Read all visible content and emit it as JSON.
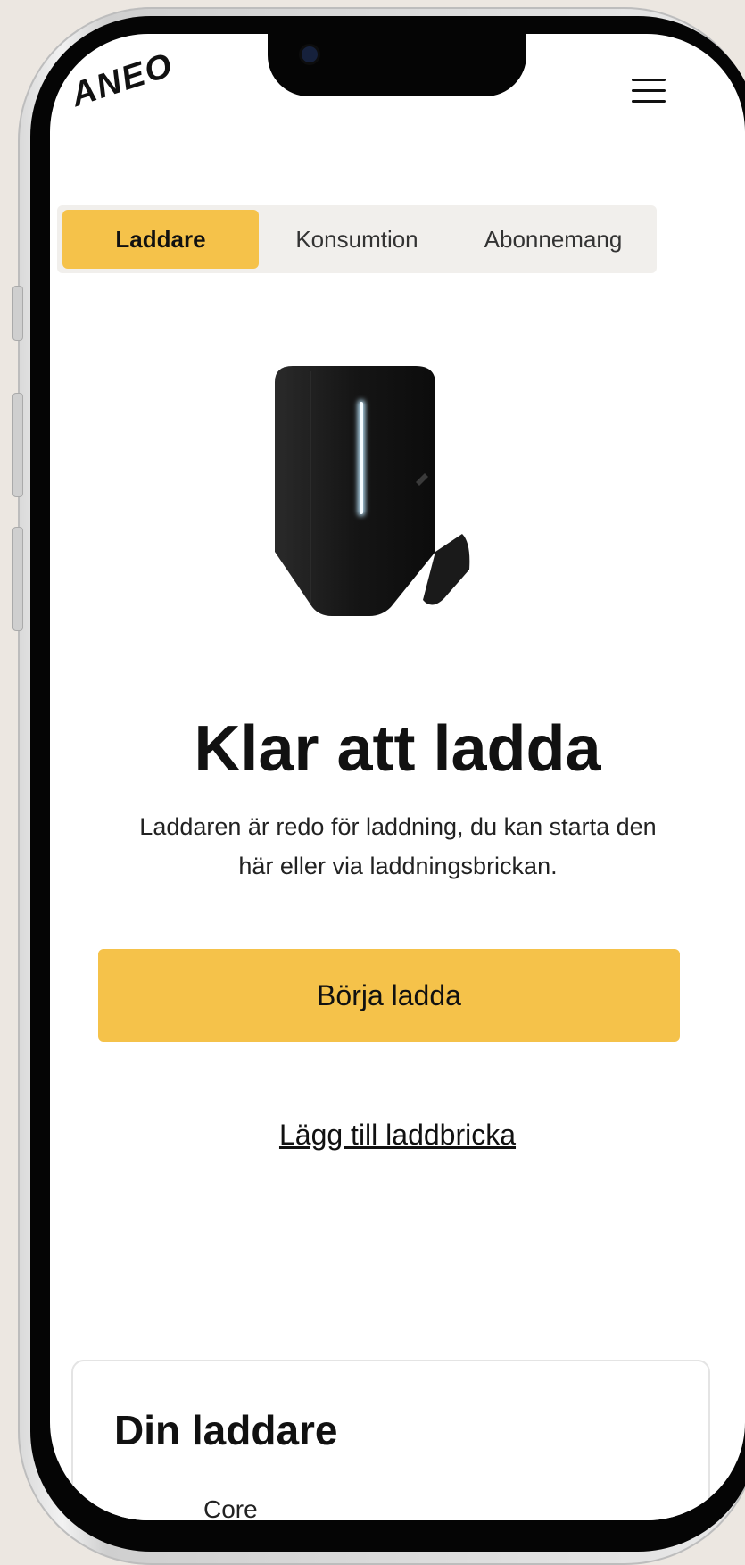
{
  "header": {
    "logo": "ANEO",
    "menu_icon": "hamburger-menu-icon"
  },
  "tabs": [
    {
      "label": "Laddare",
      "active": true
    },
    {
      "label": "Konsumtion",
      "active": false
    },
    {
      "label": "Abonnemang",
      "active": false
    }
  ],
  "main": {
    "image": "ev-charger-image",
    "title": "Klar att ladda",
    "description": "Laddaren är redo för laddning, du kan starta den här eller via laddningsbrickan.",
    "primary_button": "Börja ladda",
    "secondary_link": "Lägg till laddbricka"
  },
  "card": {
    "title": "Din laddare",
    "subtitle": "Core"
  },
  "colors": {
    "accent": "#f5c24a",
    "text": "#111111",
    "tab_bar_bg": "#f1efec"
  }
}
